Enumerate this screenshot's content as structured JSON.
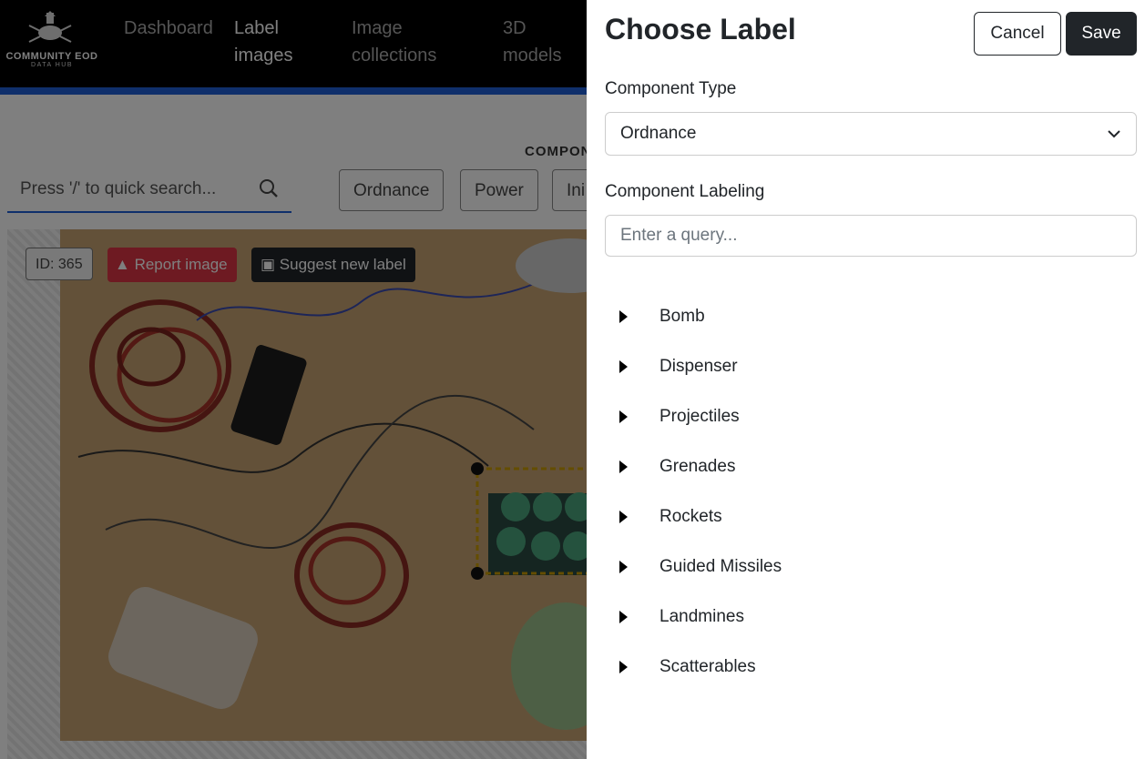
{
  "navbar": {
    "logo_title": "COMMUNITY EOD",
    "logo_subtitle": "DATA HUB",
    "items": [
      {
        "label": "Dashboard"
      },
      {
        "label": "Label images"
      },
      {
        "label": "Image collections"
      },
      {
        "label": "3D models"
      }
    ],
    "active_item": "Label images",
    "accent_color": "#1f5fd6"
  },
  "page": {
    "component_heading": "COMPON",
    "search": {
      "placeholder": "Press '/' to quick search...",
      "icon": "search-icon"
    },
    "component_chips": [
      {
        "label": "Ordnance"
      },
      {
        "label": "Power"
      },
      {
        "label": "Ini"
      }
    ],
    "image_toolbar": {
      "id_label": "ID: 365",
      "report_label": "Report image",
      "report_icon": "warning-icon",
      "suggest_label": "Suggest new label",
      "suggest_icon": "comment-icon",
      "report_color": "#dc3545",
      "suggest_color": "#212529"
    }
  },
  "panel": {
    "title": "Choose Label",
    "cancel_label": "Cancel",
    "save_label": "Save",
    "component_type_label": "Component Type",
    "component_type_value": "Ordnance",
    "component_labeling_label": "Component Labeling",
    "query_placeholder": "Enter a query...",
    "categories": [
      {
        "label": "Bomb"
      },
      {
        "label": "Dispenser"
      },
      {
        "label": "Projectiles"
      },
      {
        "label": "Grenades"
      },
      {
        "label": "Rockets"
      },
      {
        "label": "Guided Missiles"
      },
      {
        "label": "Landmines"
      },
      {
        "label": "Scatterables"
      }
    ]
  }
}
